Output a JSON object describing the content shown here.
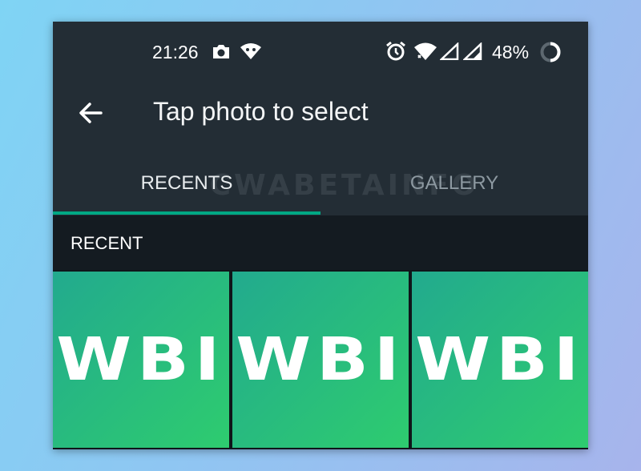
{
  "status_bar": {
    "time": "21:26",
    "battery": "48%",
    "icons": [
      "camera-icon",
      "vpn-icon",
      "alarm-icon",
      "wifi-icon",
      "signal-icon",
      "signal-icon",
      "battery-ring-icon"
    ]
  },
  "app_bar": {
    "back_icon": "arrow-back-icon",
    "title": "Tap photo to select"
  },
  "tabs": [
    {
      "label": "RECENTS",
      "active": true
    },
    {
      "label": "GALLERY",
      "active": false
    }
  ],
  "watermark": "CWABETAINFO",
  "section": {
    "label": "RECENT"
  },
  "thumbnails": [
    {
      "label": "WBI"
    },
    {
      "label": "WBI"
    },
    {
      "label": "WBI"
    }
  ],
  "colors": {
    "background": "#232d35",
    "section_bg": "#141b21",
    "accent": "#00a884",
    "thumb_green": "#2ecc6f",
    "thumb_teal": "#22aa8e"
  }
}
